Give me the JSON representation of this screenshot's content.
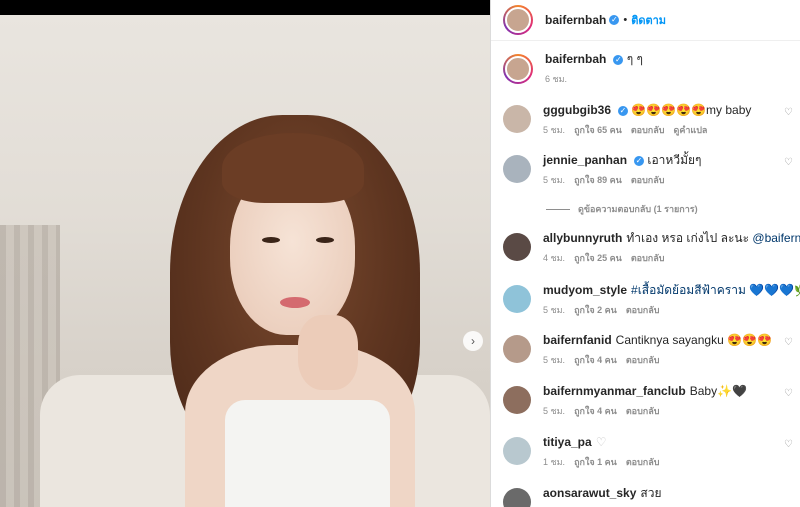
{
  "post": {
    "author": "baifernbah",
    "follow_label": "ติดตาม",
    "caption": "ๆ ๆ",
    "caption_time": "6 ชม.",
    "next_arrow": "›"
  },
  "comments": [
    {
      "user": "gggubgib36",
      "verified": true,
      "text": "😍😍😍😍😍my baby",
      "time": "5 ชม.",
      "likes": "ถูกใจ 65 คน",
      "reply": "ตอบกลับ",
      "extra": "ดูคำแปล",
      "avatar_color": "#c9b6a8"
    },
    {
      "user": "jennie_panhan",
      "verified": true,
      "text": "เอาหวีมั้ยๆ",
      "time": "5 ชม.",
      "likes": "ถูกใจ 89 คน",
      "reply": "ตอบกลับ",
      "extra": "",
      "avatar_color": "#a9b3bd"
    },
    {
      "user": "allybunnyruth",
      "verified": false,
      "text": "ทำเอง หรอ เก่งไป ละนะ",
      "mention": "@baifernbah",
      "emoji": "😍",
      "time": "4 ชม.",
      "likes": "ถูกใจ 25 คน",
      "reply": "ตอบกลับ",
      "extra": "",
      "avatar_color": "#5a4a45"
    },
    {
      "user": "mudyom_style",
      "verified": false,
      "hashtag": "#เสื้อมัดย้อมสีฟ้าคราม",
      "text": "💙💙💙🌿🌿",
      "time": "5 ชม.",
      "likes": "ถูกใจ 2 คน",
      "reply": "ตอบกลับ",
      "extra": "",
      "avatar_color": "#8fc3d9"
    },
    {
      "user": "baifernfanid",
      "verified": false,
      "text": "Cantiknya sayangku 😍😍😍",
      "time": "5 ชม.",
      "likes": "ถูกใจ 4 คน",
      "reply": "ตอบกลับ",
      "extra": "",
      "avatar_color": "#b59a8a"
    },
    {
      "user": "baifernmyanmar_fanclub",
      "verified": false,
      "text": "Baby✨🖤",
      "time": "5 ชม.",
      "likes": "ถูกใจ 4 คน",
      "reply": "ตอบกลับ",
      "extra": "",
      "avatar_color": "#8d6e5e"
    },
    {
      "user": "titiya_pa",
      "verified": false,
      "text": "♡",
      "time": "1 ชม.",
      "likes": "ถูกใจ 1 คน",
      "reply": "ตอบกลับ",
      "extra": "",
      "avatar_color": "#b8c8cf"
    },
    {
      "user": "aonsarawut_sky",
      "verified": false,
      "text": "สวย",
      "time": "",
      "likes": "",
      "reply": "",
      "extra": "",
      "avatar_color": "#6a6a6a"
    }
  ],
  "replies_toggle": "ดูข้อความตอบกลับ (1 รายการ)",
  "colors": {
    "link": "#0095f6",
    "muted": "#8e8e8e",
    "text": "#262626",
    "verified": "#3897f0"
  }
}
